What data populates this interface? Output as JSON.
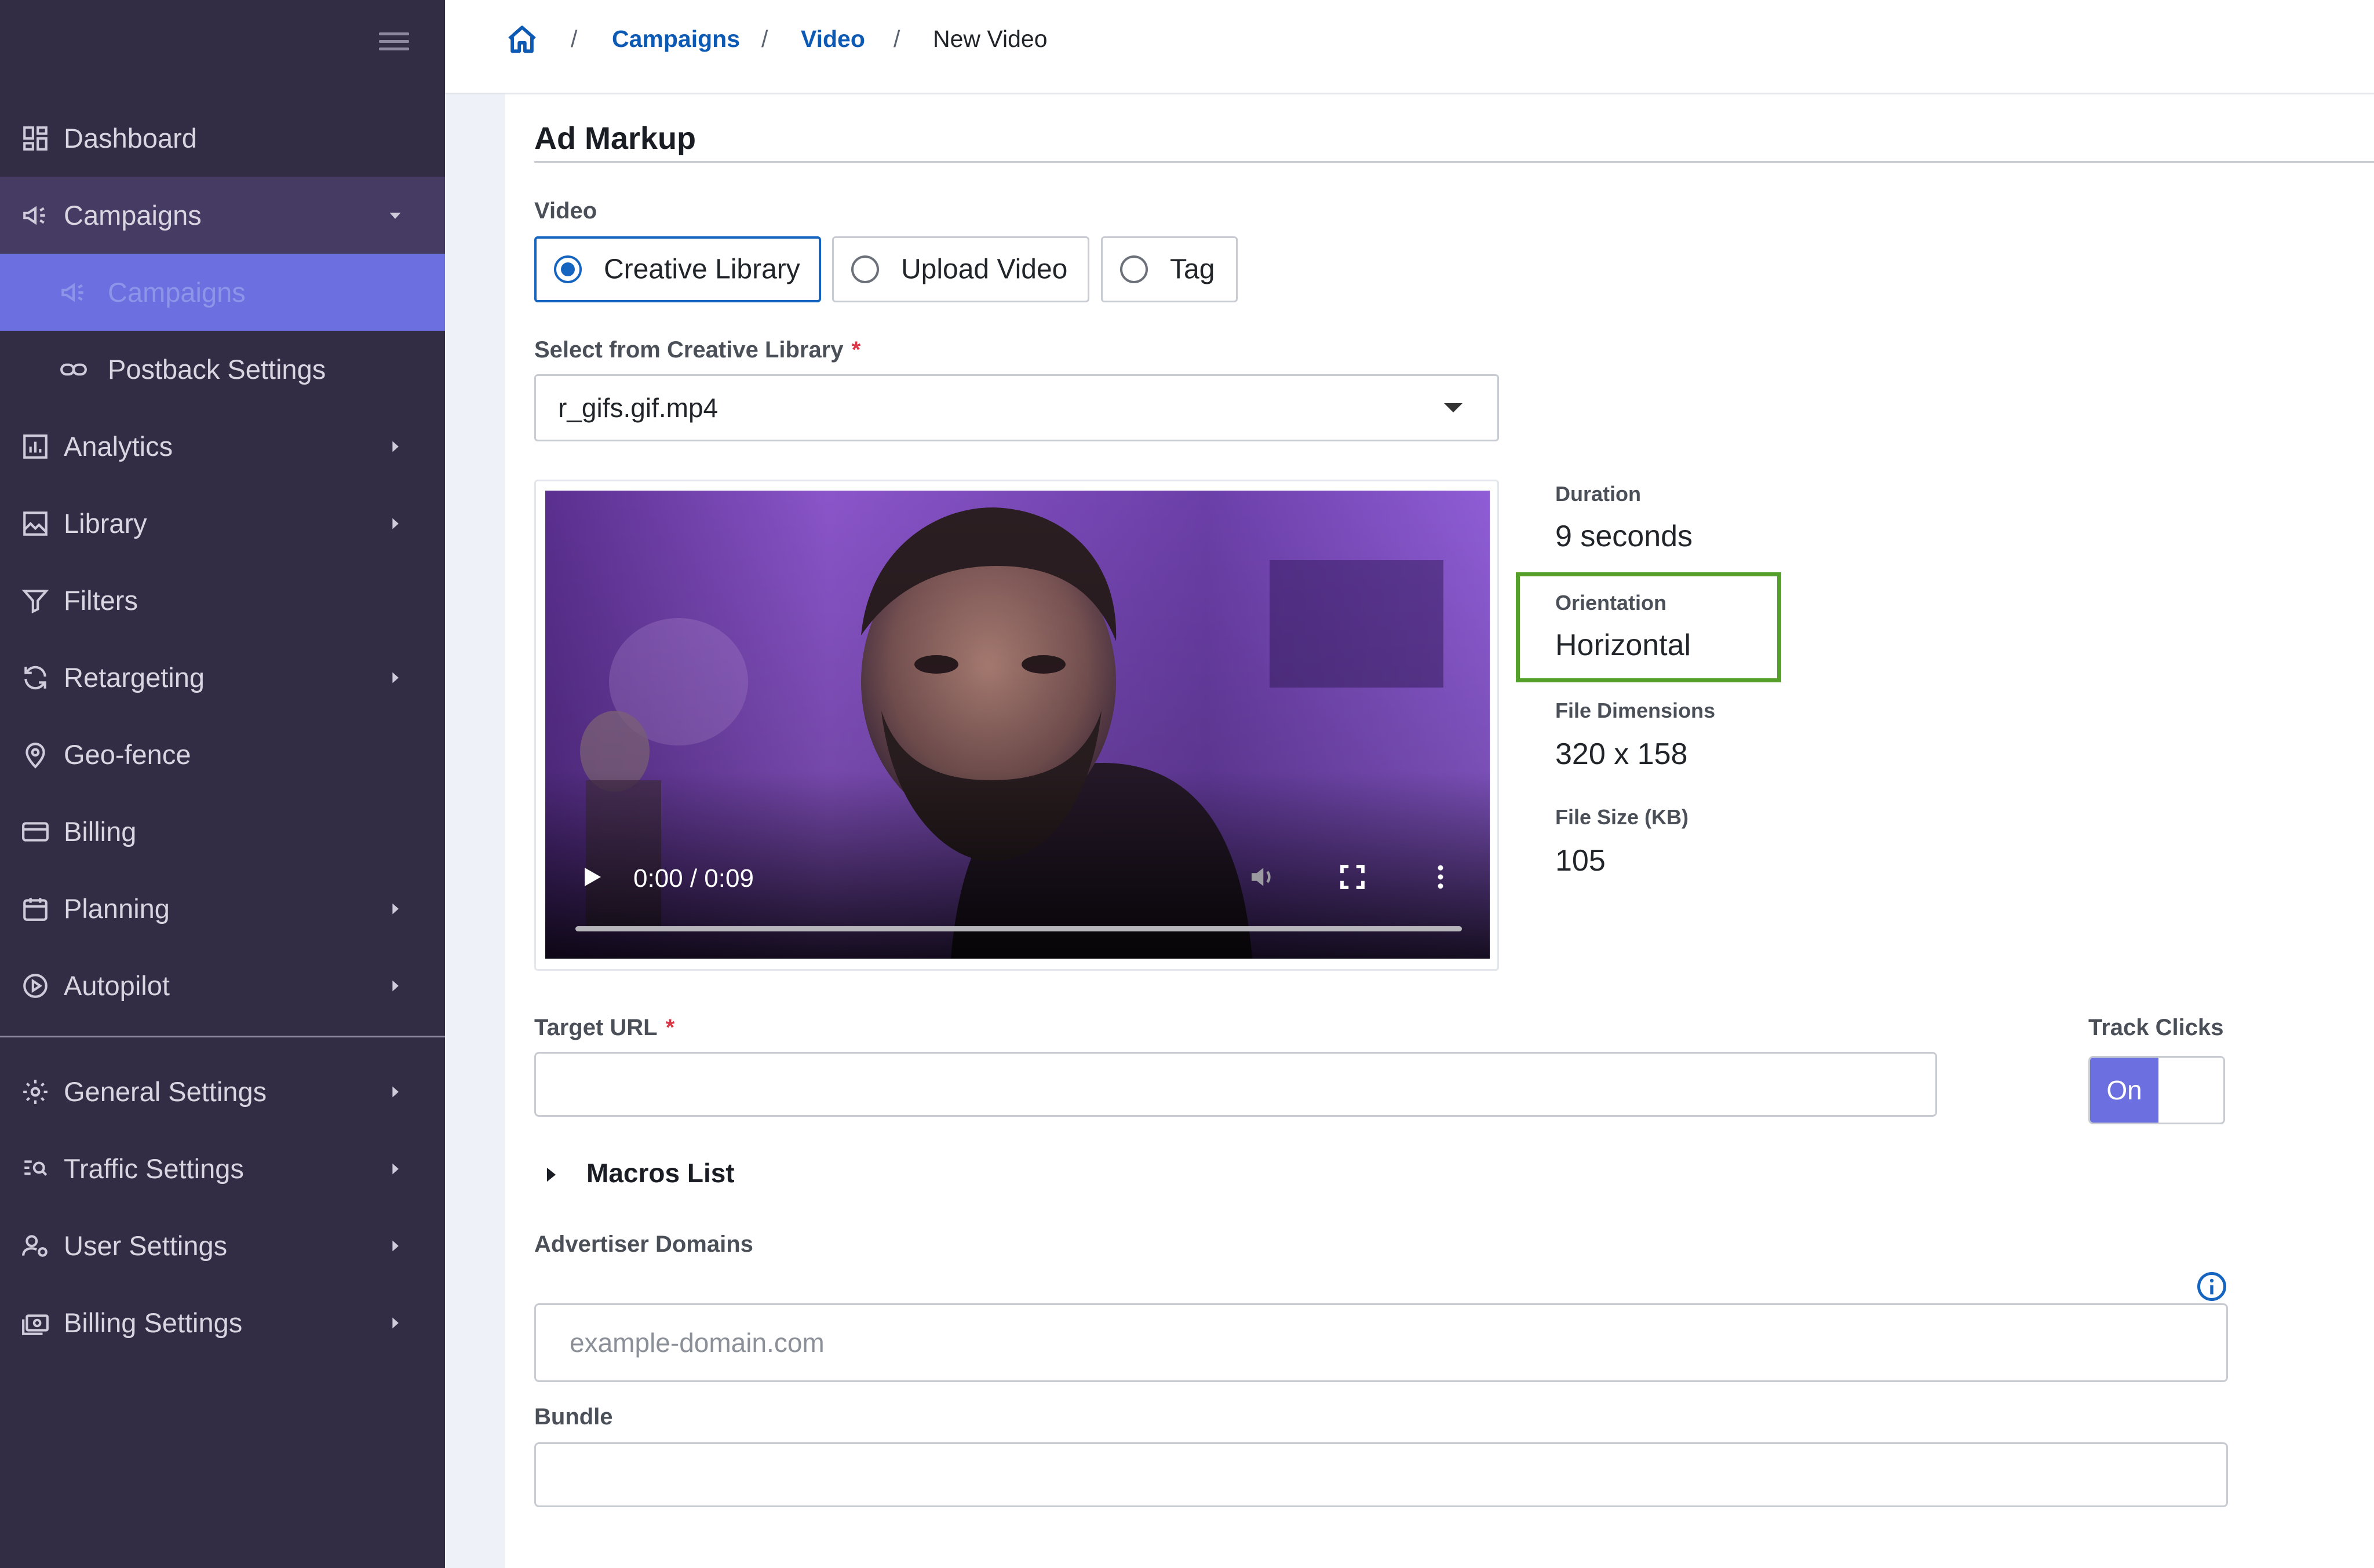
{
  "sidebar": {
    "items": [
      {
        "label": "Dashboard",
        "icon": "dashboard-icon"
      },
      {
        "label": "Campaigns",
        "icon": "megaphone-icon",
        "chevron": "chevron-down-icon"
      },
      {
        "label": "Campaigns",
        "icon": "megaphone-icon"
      },
      {
        "label": "Postback Settings",
        "icon": "link-icon"
      },
      {
        "label": "Analytics",
        "icon": "bar-chart-icon",
        "chevron": "chevron-right-icon"
      },
      {
        "label": "Library",
        "icon": "image-icon",
        "chevron": "chevron-right-icon"
      },
      {
        "label": "Filters",
        "icon": "filter-icon"
      },
      {
        "label": "Retargeting",
        "icon": "refresh-icon",
        "chevron": "chevron-right-icon"
      },
      {
        "label": "Geo-fence",
        "icon": "map-pin-icon"
      },
      {
        "label": "Billing",
        "icon": "credit-card-icon"
      },
      {
        "label": "Planning",
        "icon": "calendar-icon",
        "chevron": "chevron-right-icon"
      },
      {
        "label": "Autopilot",
        "icon": "play-circle-icon",
        "chevron": "chevron-right-icon"
      },
      {
        "label": "General Settings",
        "icon": "gear-icon",
        "chevron": "chevron-right-icon"
      },
      {
        "label": "Traffic Settings",
        "icon": "traffic-search-icon",
        "chevron": "chevron-right-icon"
      },
      {
        "label": "User Settings",
        "icon": "user-gear-icon",
        "chevron": "chevron-right-icon"
      },
      {
        "label": "Billing Settings",
        "icon": "money-icon",
        "chevron": "chevron-right-icon"
      }
    ]
  },
  "breadcrumb": {
    "home_icon": "home-icon",
    "items": [
      "Campaigns",
      "Video",
      "New Video"
    ],
    "separator": "/"
  },
  "section": {
    "title": "Ad Markup"
  },
  "video_source": {
    "label": "Video",
    "options": [
      "Creative Library",
      "Upload Video",
      "Tag"
    ],
    "selected": "Creative Library"
  },
  "creative_select": {
    "label": "Select from Creative Library",
    "required_mark": "*",
    "value": "r_gifs.gif.mp4"
  },
  "player": {
    "time": "0:00 / 0:09",
    "progress": 0
  },
  "meta": {
    "duration_label": "Duration",
    "duration_value": "9 seconds",
    "orientation_label": "Orientation",
    "orientation_value": "Horizontal",
    "dimensions_label": "File Dimensions",
    "dimensions_value": "320 x 158",
    "size_label": "File Size (KB)",
    "size_value": "105"
  },
  "target_url": {
    "label": "Target URL",
    "required_mark": "*",
    "value": ""
  },
  "track_clicks": {
    "label": "Track Clicks",
    "state_label": "On"
  },
  "macros": {
    "label": "Macros List"
  },
  "advertiser_domains": {
    "label": "Advertiser Domains",
    "placeholder": "example-domain.com"
  },
  "bundle": {
    "label": "Bundle",
    "value": ""
  },
  "colors": {
    "sidebar_bg": "#332c45",
    "accent": "#6c6fe0",
    "link": "#0d5ab5",
    "highlight_border": "#54a02a",
    "required": "#dc3545"
  }
}
